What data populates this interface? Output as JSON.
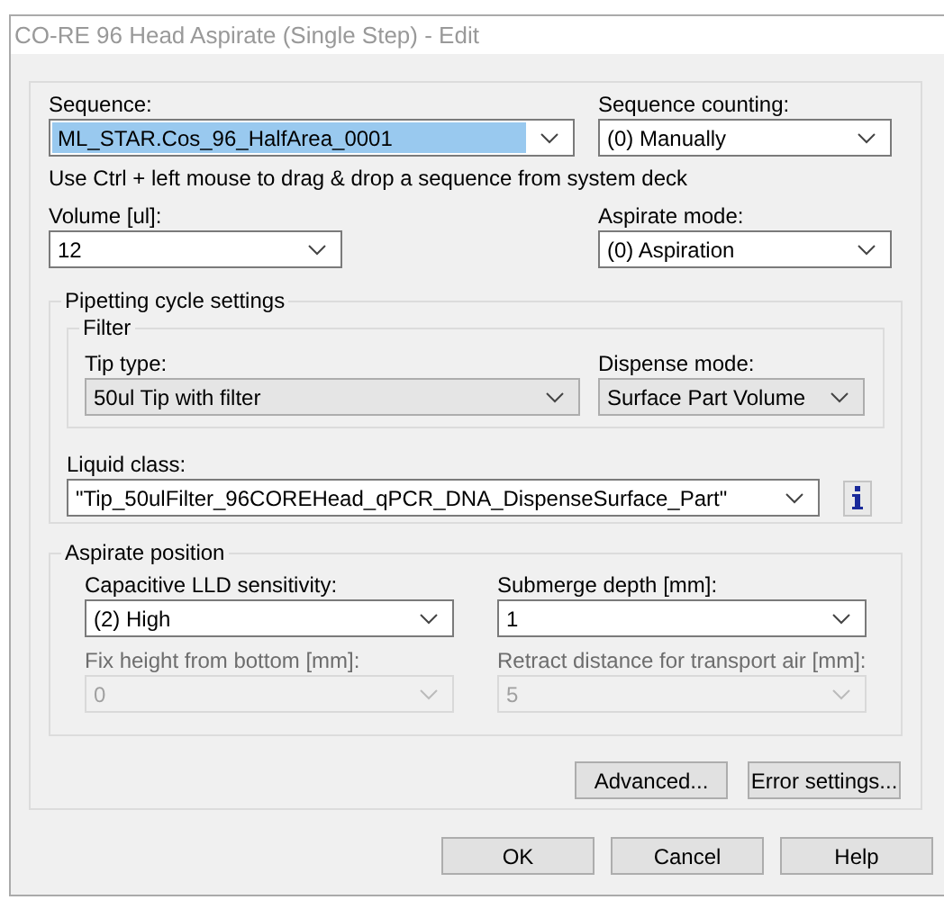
{
  "window": {
    "title": "CO-RE 96 Head Aspirate (Single Step) - Edit"
  },
  "sequence": {
    "label": "Sequence:",
    "value": "ML_STAR.Cos_96_HalfArea_0001",
    "kind": "edit",
    "highlighted": true,
    "disabled": false
  },
  "sequence_counting": {
    "label": "Sequence counting:",
    "value": "(0) Manually",
    "kind": "edit",
    "highlighted": false,
    "disabled": false
  },
  "hint": "Use Ctrl + left mouse to drag & drop a sequence from system deck",
  "volume": {
    "label": "Volume [ul]:",
    "value": "12",
    "kind": "edit",
    "highlighted": false,
    "disabled": false
  },
  "aspirate_mode": {
    "label": "Aspirate mode:",
    "value": "(0) Aspiration",
    "kind": "edit",
    "highlighted": false,
    "disabled": false
  },
  "pipetting_cycle_settings": {
    "title": "Pipetting cycle settings",
    "filter": {
      "title": "Filter",
      "tip_type": {
        "label": "Tip type:",
        "value": "50ul Tip with filter",
        "kind": "list",
        "highlighted": false,
        "disabled": false
      },
      "dispense_mode": {
        "label": "Dispense mode:",
        "value": "Surface Part Volume",
        "kind": "list",
        "highlighted": false,
        "disabled": false
      }
    },
    "liquid_class": {
      "label": "Liquid class:",
      "value": "\"Tip_50ulFilter_96COREHead_qPCR_DNA_DispenseSurface_Part\"",
      "kind": "edit",
      "highlighted": false,
      "disabled": false
    }
  },
  "aspirate_position": {
    "title": "Aspirate position",
    "capacitive_lld_sensitivity": {
      "label": "Capacitive LLD sensitivity:",
      "value": "(2) High",
      "kind": "edit",
      "highlighted": false,
      "disabled": false
    },
    "submerge_depth": {
      "label": "Submerge depth [mm]:",
      "value": "1",
      "kind": "edit",
      "highlighted": false,
      "disabled": false
    },
    "fix_height_from_bottom": {
      "label": "Fix height from bottom [mm]:",
      "value": "0",
      "kind": "edit",
      "highlighted": false,
      "disabled": true
    },
    "retract_distance": {
      "label": "Retract distance for transport air [mm]:",
      "value": "5",
      "kind": "edit",
      "highlighted": false,
      "disabled": true
    }
  },
  "panel_buttons": [
    "Advanced...",
    "Error settings..."
  ],
  "dialog_buttons": [
    "OK",
    "Cancel",
    "Help"
  ]
}
